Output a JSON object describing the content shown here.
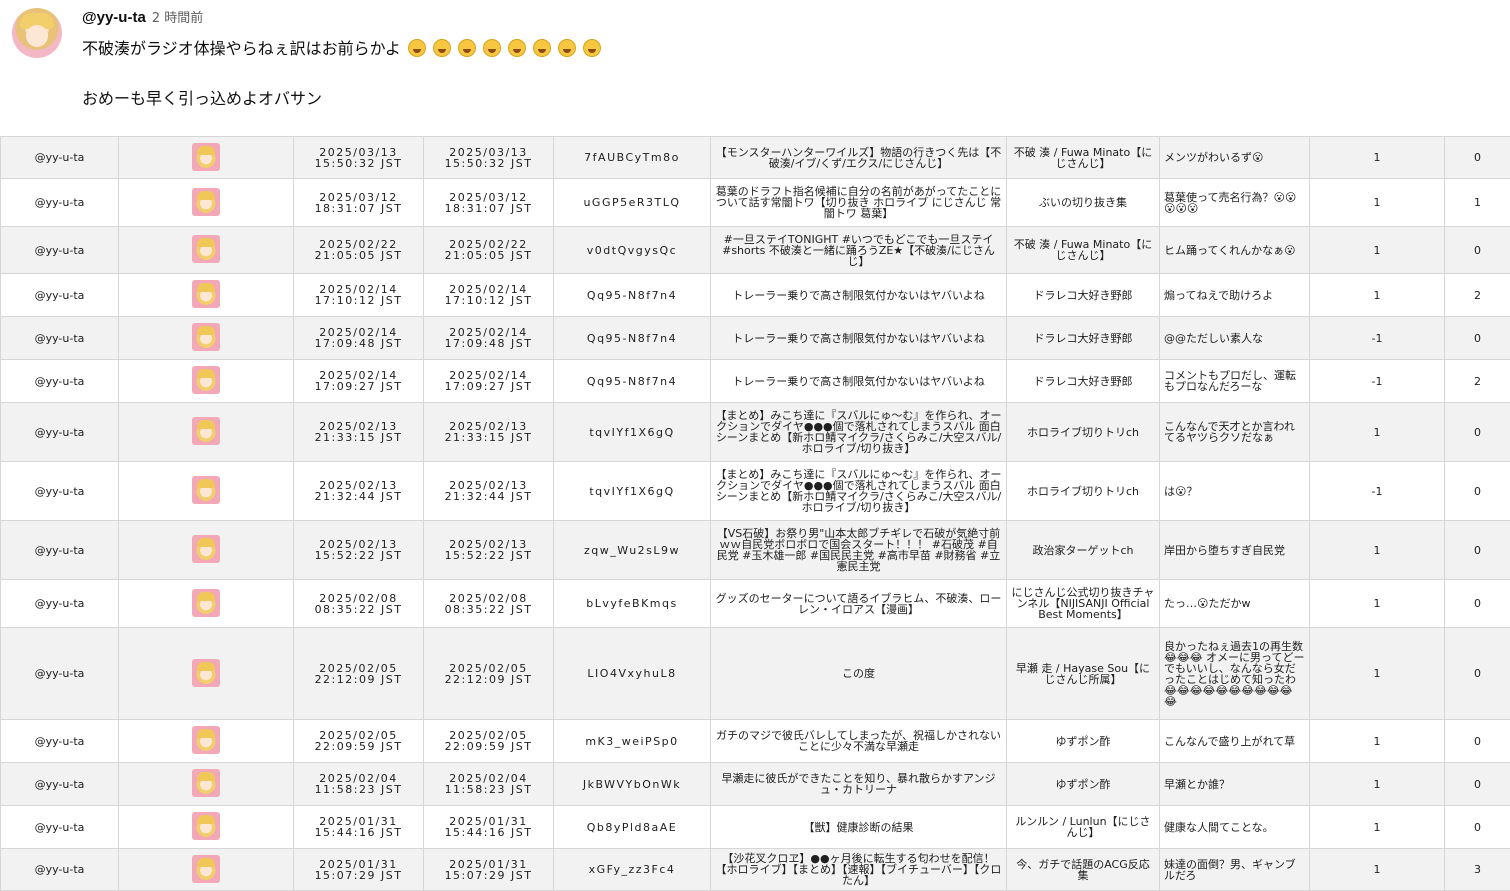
{
  "comment": {
    "author": "@yy-u-ta",
    "time": "2 時間前",
    "line1": "不破湊がラジオ体操やらねぇ訳はお前らかよ",
    "line2": "おめーも早く引っ込めよオバサン"
  },
  "rows": [
    {
      "user": "@yy-u-ta",
      "d1a": "2025/03/13",
      "d1b": "15:50:32 JST",
      "d2a": "2025/03/13",
      "d2b": "15:50:32 JST",
      "vid": "7fAUBCyTm8o",
      "title": "【モンスターハンターワイルズ】物語の行きつく先は【不破湊/イブ/くず/エクス/にじさんじ】",
      "channel": "不破 湊 / Fuwa Minato【にじさんじ】",
      "text": "メンツがわいるず😮",
      "n1": "1",
      "n2": "0"
    },
    {
      "user": "@yy-u-ta",
      "d1a": "2025/03/12",
      "d1b": "18:31:07 JST",
      "d2a": "2025/03/12",
      "d2b": "18:31:07 JST",
      "vid": "uGGP5eR3TLQ",
      "title": "葛葉のドラフト指名候補に自分の名前があがってたことについて話す常闇トワ【切り抜き ホロライブ にじさんじ 常闇トワ 葛葉】",
      "channel": "ぶいの切り抜き集",
      "text": "葛葉使って売名行為？😮😮😮😮😮",
      "n1": "1",
      "n2": "1"
    },
    {
      "user": "@yy-u-ta",
      "d1a": "2025/02/22",
      "d1b": "21:05:05 JST",
      "d2a": "2025/02/22",
      "d2b": "21:05:05 JST",
      "vid": "v0dtQvgysQc",
      "title": "#一旦ステイTONIGHT #いつでもどこでも一旦ステイ #shorts 不破湊と一緒に踊ろうZE★【不破湊/にじさんじ】",
      "channel": "不破 湊 / Fuwa Minato【にじさんじ】",
      "text": "ヒム踊ってくれんかなぁ😮",
      "n1": "1",
      "n2": "0"
    },
    {
      "user": "@yy-u-ta",
      "d1a": "2025/02/14",
      "d1b": "17:10:12 JST",
      "d2a": "2025/02/14",
      "d2b": "17:10:12 JST",
      "vid": "Qq95-N8f7n4",
      "title": "トレーラー乗りで高さ制限気付かないはヤバいよね",
      "channel": "ドラレコ大好き野郎",
      "text": "煽ってねえで助けろよ",
      "n1": "1",
      "n2": "2"
    },
    {
      "user": "@yy-u-ta",
      "d1a": "2025/02/14",
      "d1b": "17:09:48 JST",
      "d2a": "2025/02/14",
      "d2b": "17:09:48 JST",
      "vid": "Qq95-N8f7n4",
      "title": "トレーラー乗りで高さ制限気付かないはヤバいよね",
      "channel": "ドラレコ大好き野郎",
      "text": "@@ただしい素人な",
      "n1": "-1",
      "n2": "0"
    },
    {
      "user": "@yy-u-ta",
      "d1a": "2025/02/14",
      "d1b": "17:09:27 JST",
      "d2a": "2025/02/14",
      "d2b": "17:09:27 JST",
      "vid": "Qq95-N8f7n4",
      "title": "トレーラー乗りで高さ制限気付かないはヤバいよね",
      "channel": "ドラレコ大好き野郎",
      "text": "コメントもプロだし、運転もプロなんだろーな",
      "n1": "-1",
      "n2": "2"
    },
    {
      "user": "@yy-u-ta",
      "d1a": "2025/02/13",
      "d1b": "21:33:15 JST",
      "d2a": "2025/02/13",
      "d2b": "21:33:15 JST",
      "vid": "tqvIYf1X6gQ",
      "title": "【まとめ】みこち達に『スバルにゅ～む』を作られ、オークションでダイヤ●●●個で落札されてしまうスバル 面白シーンまとめ【新ホロ鯖マイクラ/さくらみこ/大空スバル/ホロライブ/切り抜き】",
      "channel": "ホロライブ切りトリch",
      "text": "こんなんで天才とか言われてるヤツらクソだなぁ",
      "n1": "1",
      "n2": "0"
    },
    {
      "user": "@yy-u-ta",
      "d1a": "2025/02/13",
      "d1b": "21:32:44 JST",
      "d2a": "2025/02/13",
      "d2b": "21:32:44 JST",
      "vid": "tqvIYf1X6gQ",
      "title": "【まとめ】みこち達に『スバルにゅ～む』を作られ、オークションでダイヤ●●●個で落札されてしまうスバル 面白シーンまとめ【新ホロ鯖マイクラ/さくらみこ/大空スバル/ホロライブ/切り抜き】",
      "channel": "ホロライブ切りトリch",
      "text": "は😮？",
      "n1": "-1",
      "n2": "0"
    },
    {
      "user": "@yy-u-ta",
      "d1a": "2025/02/13",
      "d1b": "15:52:22 JST",
      "d2a": "2025/02/13",
      "d2b": "15:52:22 JST",
      "vid": "zqw_Wu2sL9w",
      "title": "【VS石破】お祭り男\"山本太郎ブチギレで石破が気絶寸前ｗｗ自民党ボロボロで国会スタート！！！ #石破茂 #自民党 #玉木雄一郎 #国民民主党 #高市早苗 #財務省 #立憲民主党",
      "channel": "政治家ターゲットch",
      "text": "岸田から堕ちすぎ自民党",
      "n1": "1",
      "n2": "0"
    },
    {
      "user": "@yy-u-ta",
      "d1a": "2025/02/08",
      "d1b": "08:35:22 JST",
      "d2a": "2025/02/08",
      "d2b": "08:35:22 JST",
      "vid": "bLvyfeBKmqs",
      "title": "グッズのセーターについて語るイブラヒム、不破湊、ローレン・イロアス【漫画】",
      "channel": "にじさんじ公式切り抜きチャンネル【NIJISANJI Official Best Moments】",
      "text": "たっ…😮ただかw",
      "n1": "1",
      "n2": "0"
    },
    {
      "user": "@yy-u-ta",
      "d1a": "2025/02/05",
      "d1b": "22:12:09 JST",
      "d2a": "2025/02/05",
      "d2b": "22:12:09 JST",
      "vid": "LIO4VxyhuL8",
      "title": "この度",
      "channel": "早瀬 走 / Hayase Sou【にじさんじ所属】",
      "text": "良かったねぇ過去1の再生数😂😂😂 オメーに男ってどーでもいいし、なんなら女だったことはじめて知ったわ😂😂😂😂😂😂😂😂😂😂😂",
      "n1": "1",
      "n2": "0"
    },
    {
      "user": "@yy-u-ta",
      "d1a": "2025/02/05",
      "d1b": "22:09:59 JST",
      "d2a": "2025/02/05",
      "d2b": "22:09:59 JST",
      "vid": "mK3_weiPSp0",
      "title": "ガチのマジで彼氏バレしてしまったが、祝福しかされないことに少々不満な早瀬走",
      "channel": "ゆずポン酢",
      "text": "こんなんで盛り上がれて草",
      "n1": "1",
      "n2": "0"
    },
    {
      "user": "@yy-u-ta",
      "d1a": "2025/02/04",
      "d1b": "11:58:23 JST",
      "d2a": "2025/02/04",
      "d2b": "11:58:23 JST",
      "vid": "JkBWVYbOnWk",
      "title": "早瀬走に彼氏ができたことを知り、暴れ散らかすアンジュ・カトリーナ",
      "channel": "ゆずポン酢",
      "text": "早瀬とか誰？",
      "n1": "1",
      "n2": "0"
    },
    {
      "user": "@yy-u-ta",
      "d1a": "2025/01/31",
      "d1b": "15:44:16 JST",
      "d2a": "2025/01/31",
      "d2b": "15:44:16 JST",
      "vid": "Qb8yPld8aAE",
      "title": "【獣】健康診断の結果",
      "channel": "ルンルン / Lunlun【にじさんじ】",
      "text": "健康な人間てことな。",
      "n1": "1",
      "n2": "0"
    },
    {
      "user": "@yy-u-ta",
      "d1a": "2025/01/31",
      "d1b": "15:07:29 JST",
      "d2a": "2025/01/31",
      "d2b": "15:07:29 JST",
      "vid": "xGFy_zz3Fc4",
      "title": "【沙花叉クロヱ】●●ヶ月後に転生する匂わせを配信！【ホロライブ】【まとめ】【速報】【ブイチューバー】【クロたん】",
      "channel": "今、ガチで話題のACG反応集",
      "text": "妹達の面倒？男、ギャンブルだろ",
      "n1": "1",
      "n2": "3"
    }
  ]
}
